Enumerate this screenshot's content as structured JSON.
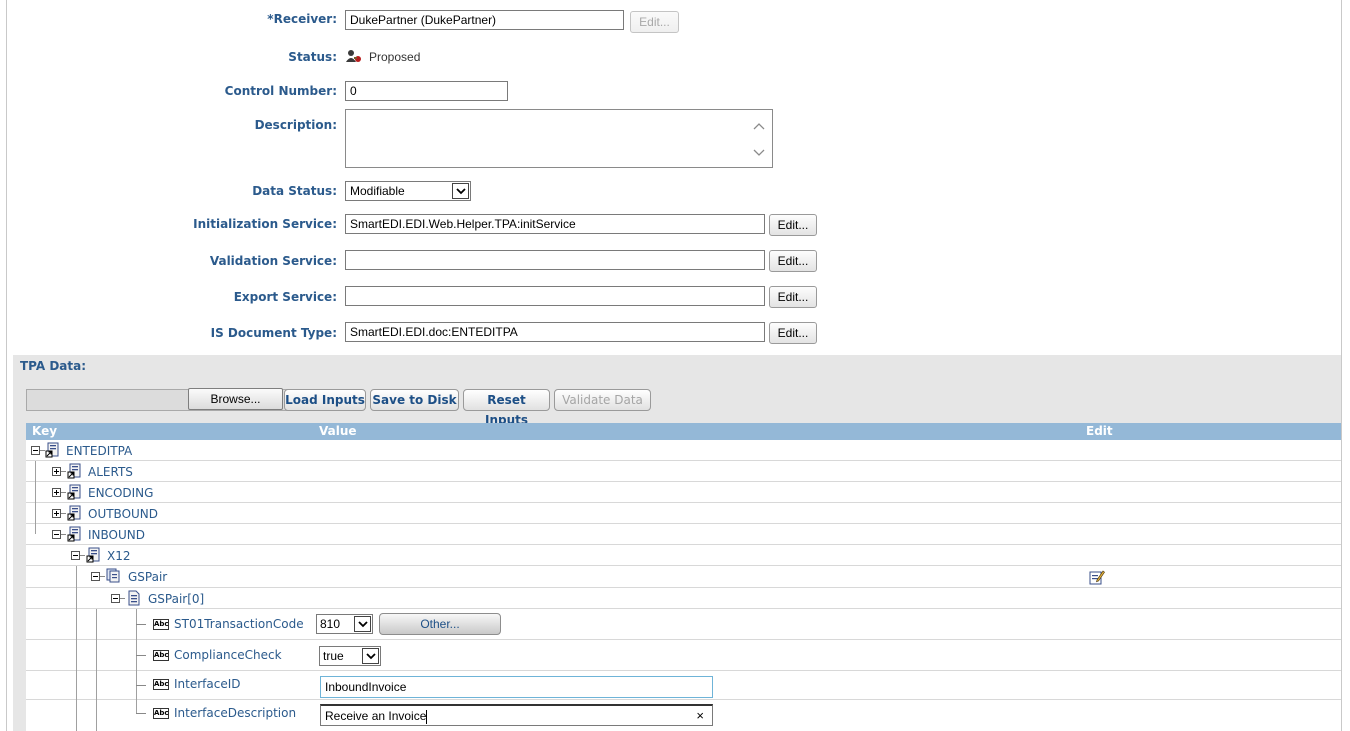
{
  "form": {
    "receiver": {
      "label": "*Receiver:",
      "value": "DukePartner (DukePartner)",
      "edit_label": "Edit..."
    },
    "status": {
      "label": "Status:",
      "value": "Proposed"
    },
    "control_number": {
      "label": "Control Number:",
      "value": "0"
    },
    "description": {
      "label": "Description:",
      "value": ""
    },
    "data_status": {
      "label": "Data Status:",
      "value": "Modifiable"
    },
    "init_service": {
      "label": "Initialization Service:",
      "value": "SmartEDI.EDI.Web.Helper.TPA:initService",
      "edit_label": "Edit..."
    },
    "validation_service": {
      "label": "Validation Service:",
      "value": "",
      "edit_label": "Edit..."
    },
    "export_service": {
      "label": "Export Service:",
      "value": "",
      "edit_label": "Edit..."
    },
    "is_document_type": {
      "label": "IS Document Type:",
      "value": "SmartEDI.EDI.doc:ENTEDITPA",
      "edit_label": "Edit..."
    }
  },
  "tpa": {
    "title": "TPA Data:",
    "toolbar": {
      "browse": "Browse...",
      "load": "Load Inputs",
      "save": "Save to Disk",
      "reset": "Reset Inputs",
      "validate": "Validate Data"
    },
    "columns": {
      "key": "Key",
      "value": "Value",
      "edit": "Edit"
    },
    "tree": {
      "root": "ENTEDITPA",
      "alerts": "ALERTS",
      "encoding": "ENCODING",
      "outbound": "OUTBOUND",
      "inbound": "INBOUND",
      "x12": "X12",
      "gspair": "GSPair",
      "gspair0": "GSPair[0]",
      "st01": {
        "key": "ST01TransactionCode",
        "value": "810",
        "other_label": "Other..."
      },
      "compliance": {
        "key": "ComplianceCheck",
        "value": "true"
      },
      "interface_id": {
        "key": "InterfaceID",
        "value": "InboundInvoice"
      },
      "interface_desc": {
        "key": "InterfaceDescription",
        "value": "Receive an Invoice",
        "clear": "×"
      }
    }
  },
  "colors": {
    "label_blue": "#2b5a8c",
    "header_blue": "#94b8d7",
    "panel_gray": "#e6e6e6"
  },
  "icons": [
    "person-key-icon",
    "document-shortcut-icon",
    "documents-stack-icon",
    "document-icon",
    "abc-field-icon",
    "edit-pencil-icon",
    "chevron-down-icon"
  ]
}
